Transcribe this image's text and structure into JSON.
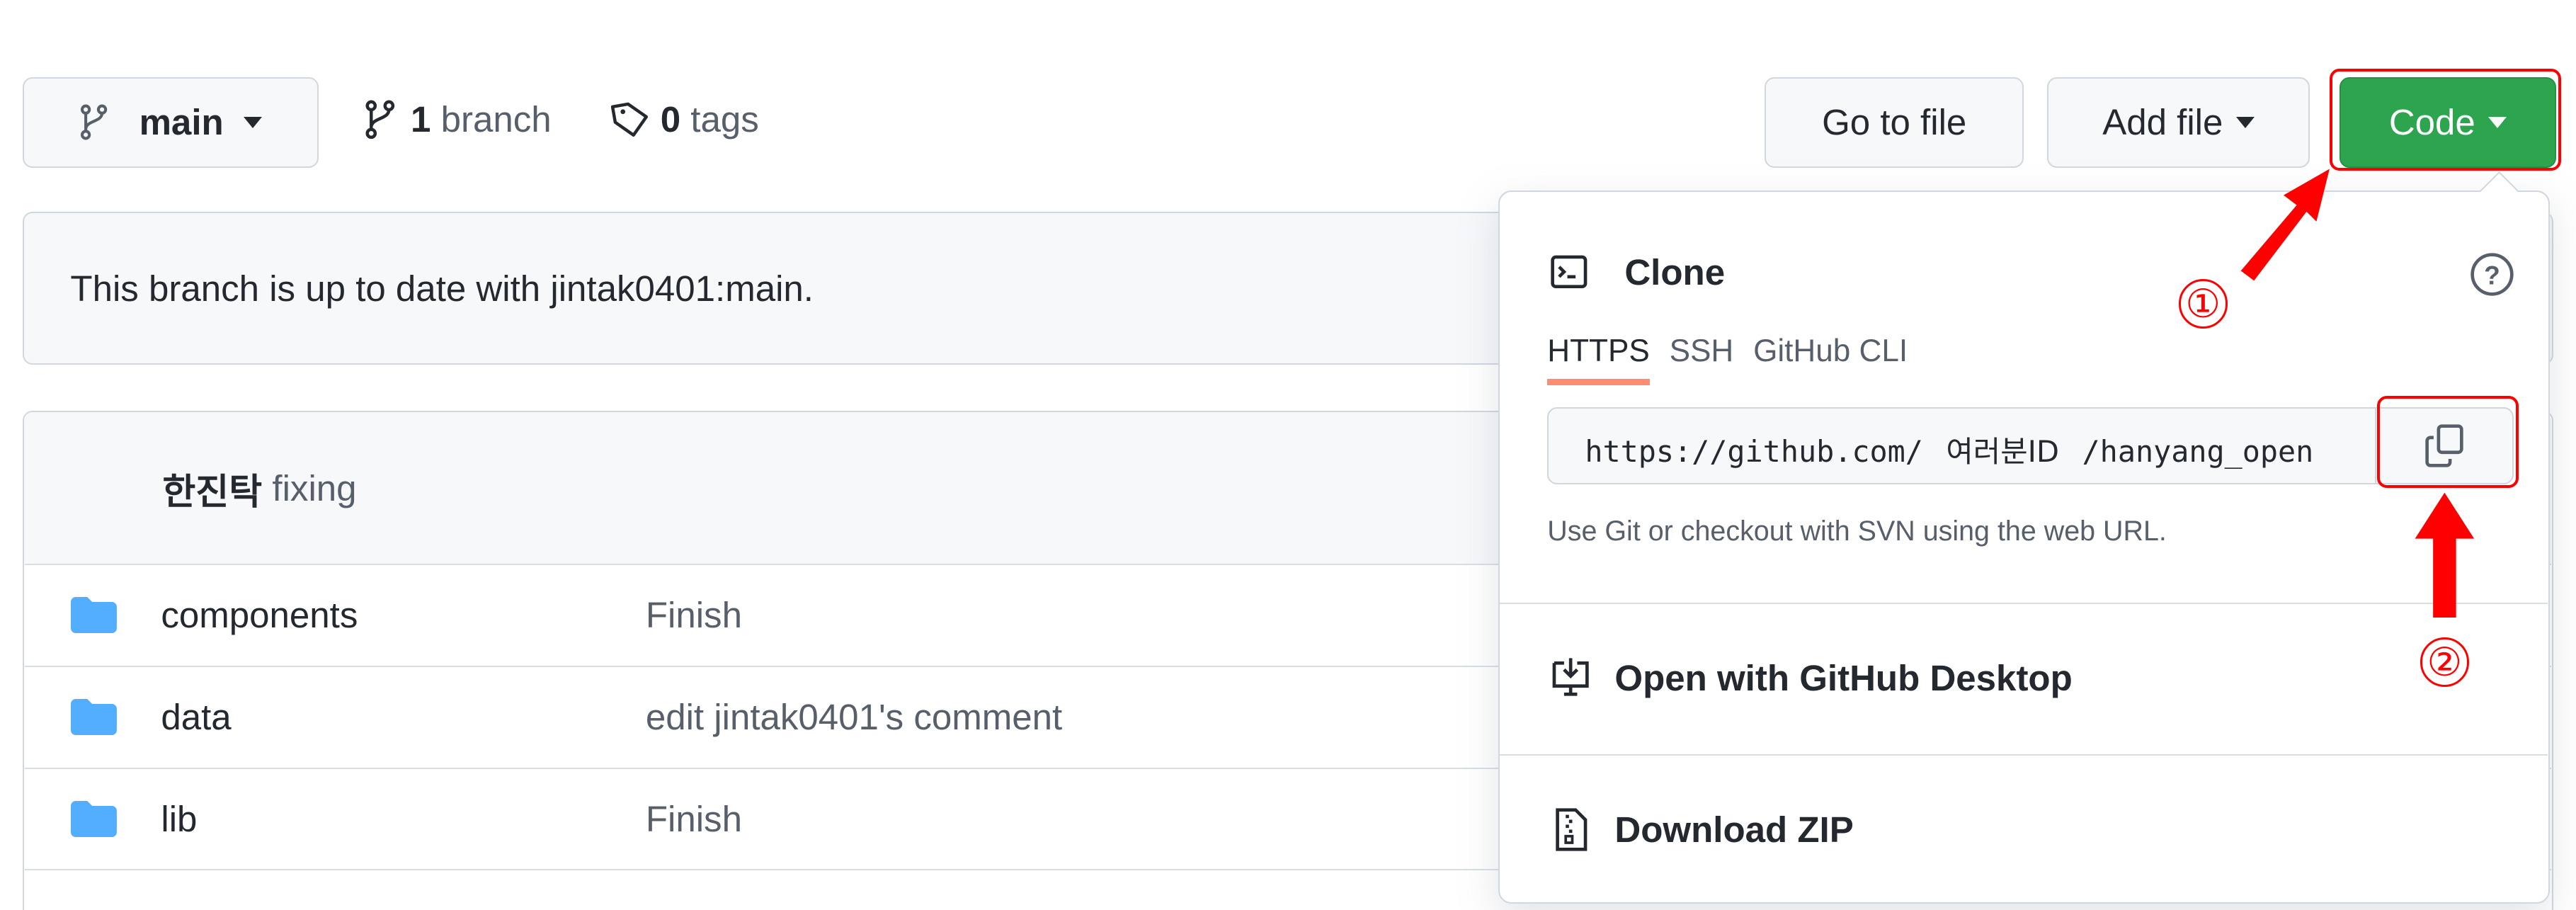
{
  "branch_selector": {
    "label": "main"
  },
  "branch_count": {
    "number": "1",
    "label": "branch"
  },
  "tag_count": {
    "number": "0",
    "label": "tags"
  },
  "buttons": {
    "go_to_file": "Go to file",
    "add_file": "Add file",
    "code": "Code"
  },
  "banner": {
    "text": "This branch is up to date with jintak0401:main."
  },
  "latest_commit": {
    "author": "한진탁",
    "message": "fixing"
  },
  "files": [
    {
      "name": "components",
      "message": "Finish"
    },
    {
      "name": "data",
      "message": "edit jintak0401's comment"
    },
    {
      "name": "lib",
      "message": "Finish"
    }
  ],
  "clone_popup": {
    "title": "Clone",
    "tabs": [
      "HTTPS",
      "SSH",
      "GitHub CLI"
    ],
    "active_tab": "HTTPS",
    "url_prefix": "https://github.com/",
    "url_id": "여러분ID",
    "url_suffix": "/hanyang_open",
    "help_text": "Use Git or checkout with SVN using the web URL.",
    "open_desktop": "Open with GitHub Desktop",
    "download_zip": "Download ZIP"
  },
  "annotations": {
    "step1": "①",
    "step2": "②"
  },
  "colors": {
    "code_green": "#2da44e",
    "annotation_red": "#ff0000",
    "tab_underline": "#fd8c73"
  }
}
